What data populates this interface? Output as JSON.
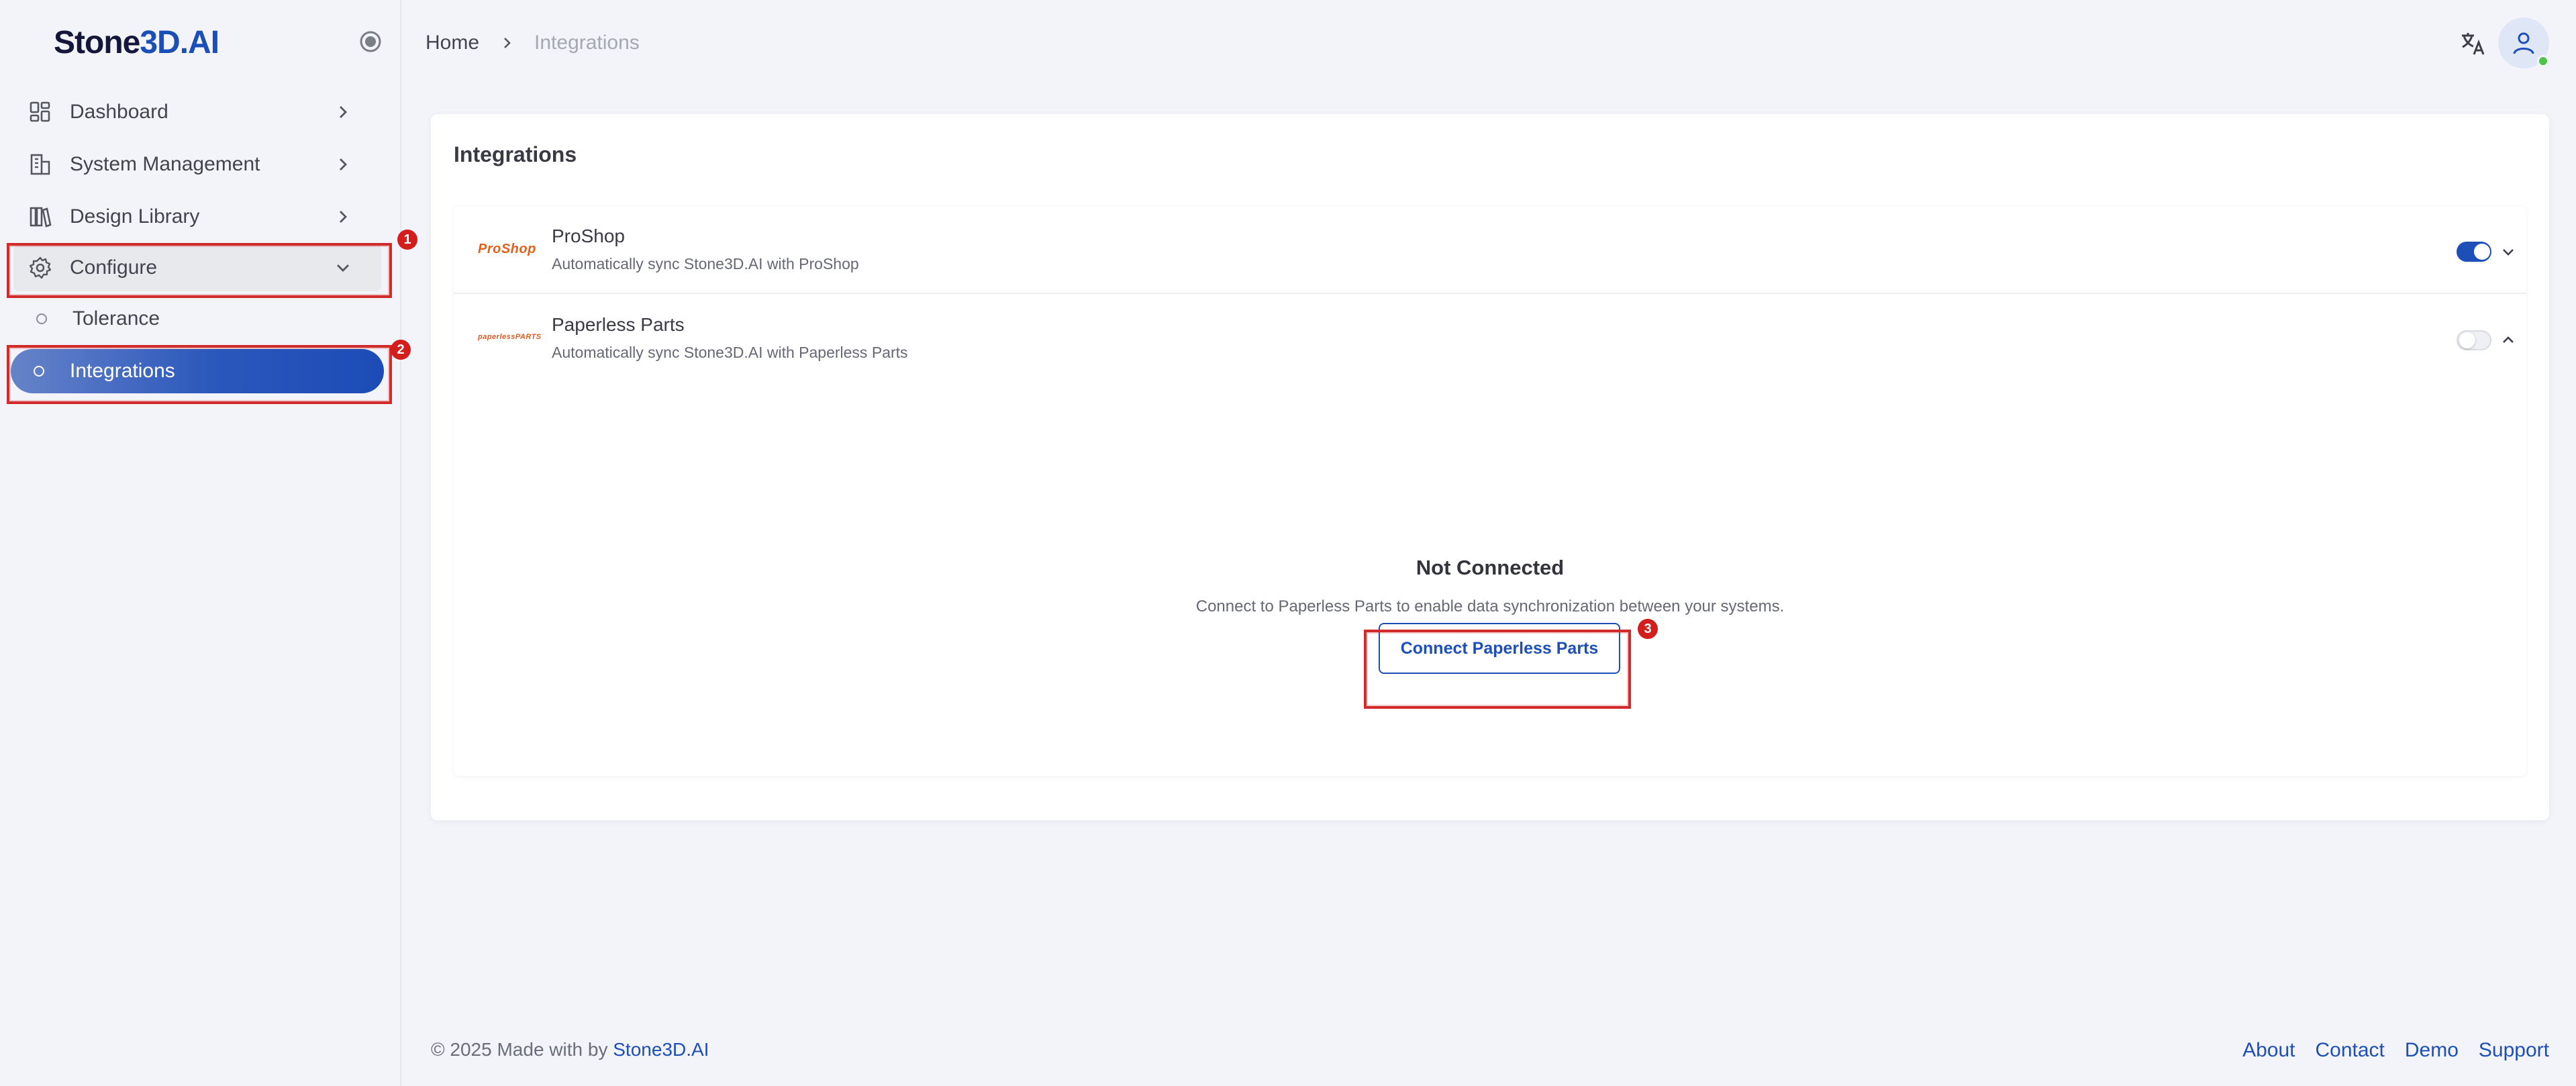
{
  "app": {
    "logo_text": "Stone",
    "logo_accent": "3D.AI"
  },
  "sidebar": {
    "items": [
      {
        "label": "Dashboard",
        "icon": "dashboard-icon"
      },
      {
        "label": "System Management",
        "icon": "building-icon"
      },
      {
        "label": "Design Library",
        "icon": "library-icon"
      },
      {
        "label": "Configure",
        "icon": "gear-icon",
        "expanded": true
      }
    ],
    "sub_items": [
      {
        "label": "Tolerance",
        "active": false
      },
      {
        "label": "Integrations",
        "active": true
      }
    ]
  },
  "header": {
    "breadcrumb": {
      "home": "Home",
      "current": "Integrations"
    }
  },
  "main": {
    "title": "Integrations",
    "integrations": [
      {
        "logo": "ProShop",
        "name": "ProShop",
        "description": "Automatically sync Stone3D.AI with ProShop",
        "enabled": true,
        "expanded": false
      },
      {
        "logo": "paperlessPARTS",
        "name": "Paperless Parts",
        "description": "Automatically sync Stone3D.AI with Paperless Parts",
        "enabled": false,
        "expanded": true
      }
    ],
    "panel": {
      "title": "Not Connected",
      "description": "Connect to Paperless Parts to enable data synchronization between your systems.",
      "button_label": "Connect Paperless Parts"
    }
  },
  "annotations": [
    "1",
    "2",
    "3"
  ],
  "footer": {
    "copyright": "© 2025 Made with by ",
    "brand": "Stone3D.AI",
    "links": [
      "About",
      "Contact",
      "Demo",
      "Support"
    ]
  },
  "colors": {
    "accent": "#1e4fb8",
    "annotation": "#d22b2b",
    "status_online": "#4fc24a"
  }
}
